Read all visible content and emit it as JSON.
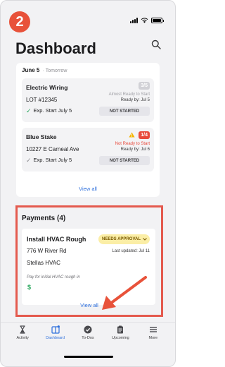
{
  "step_number": "2",
  "header": {
    "title": "Dashboard"
  },
  "day_section": {
    "date": "June 5",
    "relative": "· Tomorrow",
    "tasks": [
      {
        "title": "Electric Wiring",
        "subtitle": "LOT #12345",
        "start_label": "Exp. Start  July 5",
        "count": "3/5",
        "readiness": "Almost Ready to Start",
        "ready_by": "Ready by: Jul 5",
        "status": "NOT STARTED"
      },
      {
        "title": "Blue Stake",
        "subtitle": "10227 E Carneal Ave",
        "start_label": "Exp. Start  July 5",
        "count": "1/4",
        "readiness": "Not Ready to Start",
        "ready_by": "Ready by: Jul 6",
        "status": "NOT STARTED"
      }
    ],
    "view_all": "View all"
  },
  "payments": {
    "title": "Payments (4)",
    "card": {
      "title": "Install HVAC Rough",
      "badge": "NEEDS APPROVAL",
      "address": "776 W River Rd",
      "last_updated": "Last updated: Jul 11",
      "company": "Stellas HVAC",
      "description": "Pay for initial HVAC rough in",
      "dollar_symbol": "$"
    },
    "view_all": "View all"
  },
  "tabbar": {
    "items": [
      {
        "label": "Activity",
        "icon": "hourglass-icon"
      },
      {
        "label": "Dashboard",
        "icon": "dashboard-icon"
      },
      {
        "label": "To-Dos",
        "icon": "check-circle-icon"
      },
      {
        "label": "Upcoming",
        "icon": "clipboard-icon"
      },
      {
        "label": "More",
        "icon": "menu-icon"
      }
    ]
  },
  "colors": {
    "accent": "#2d6fdc",
    "highlight_box": "#e45a4e",
    "step_badge": "#e8523a",
    "approval_bg": "#fbeea6",
    "danger": "#e84a3c",
    "success": "#26a65b"
  }
}
